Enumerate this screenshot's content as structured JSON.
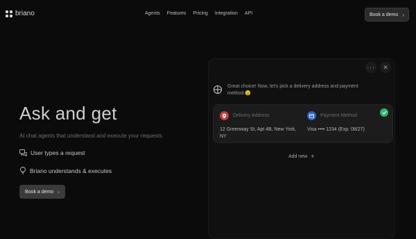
{
  "nav": {
    "brand": "briano",
    "links": [
      "Agents",
      "Features",
      "Pricing",
      "Integration",
      "API"
    ],
    "cta": "Book a demo"
  },
  "hero": {
    "title": "Ask and get",
    "subtitle": "AI chat agents that understand and execute your requests.",
    "features": [
      "User types a request",
      "Briano understands & executes"
    ],
    "cta": "Book a demo"
  },
  "panel": {
    "message": "Great choice! Now, let's pick a delivery address and payment method.😉",
    "card": {
      "address_label": "Delivery Address",
      "address_value": "12 Greenway St, Apt 4B, New York, NY",
      "payment_label": "Payment Method",
      "payment_value": "Visa •••• 1234 (Exp. 08/27)"
    },
    "add_new": "Add new"
  },
  "colors": {
    "background": "#0b0b0b",
    "pin": "#c93a3a",
    "payment": "#2f67c4",
    "check": "#2bb673"
  },
  "icons": [
    "briano-logo-icon",
    "chevron-right-icon",
    "chat-icon",
    "bulb-icon",
    "more-icon",
    "close-icon",
    "location-pin-icon",
    "card-icon",
    "check-icon",
    "plus-icon"
  ]
}
